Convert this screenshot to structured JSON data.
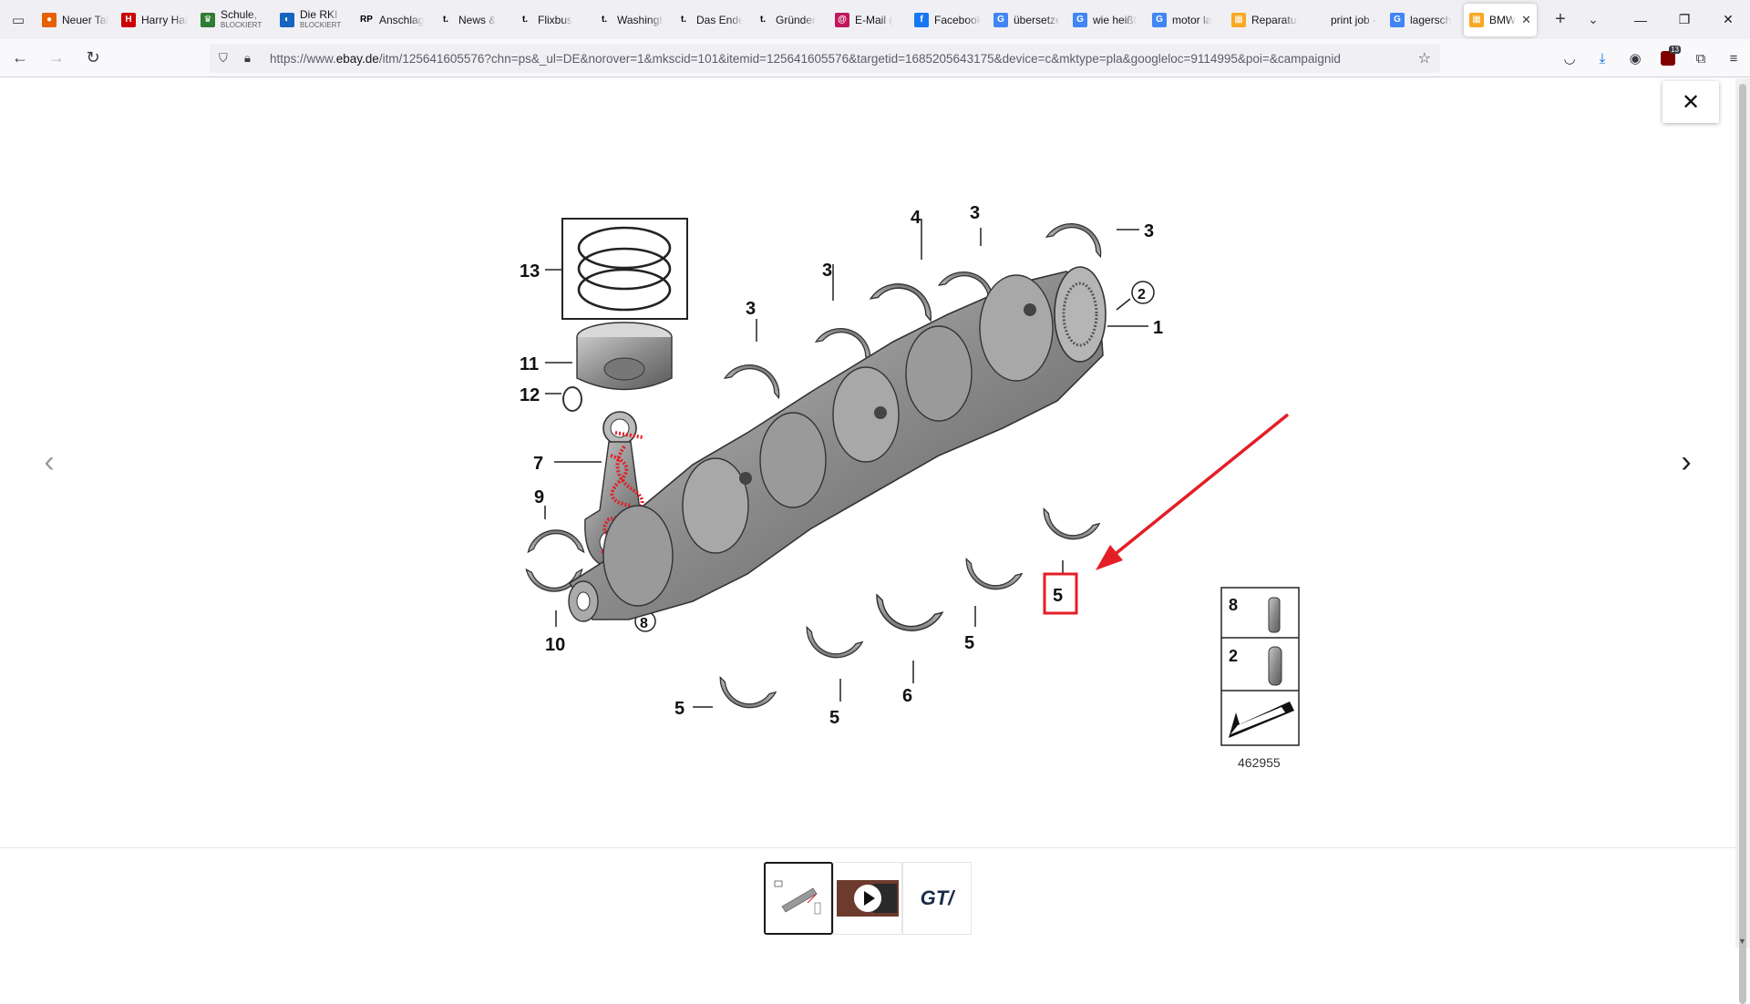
{
  "tabs": [
    {
      "title": "Neuer Tab",
      "fav_color": "#e66000",
      "fav_glyph": "●"
    },
    {
      "title": "Harry Hanks",
      "fav_color": "#cc0000",
      "fav_glyph": "H"
    },
    {
      "title": "Schule,",
      "sub": "BLOCKIERT",
      "fav_color": "#2e7d32",
      "fav_glyph": "♛"
    },
    {
      "title": "Die RKI",
      "sub": "BLOCKIERT",
      "fav_color": "#1565c0",
      "fav_glyph": "◐"
    },
    {
      "title": "Anschlag",
      "fav_color": "#000000",
      "fav_glyph": "RP"
    },
    {
      "title": "News &",
      "fav_color": "#000000",
      "fav_glyph": "t."
    },
    {
      "title": "Flixbus",
      "fav_color": "#000000",
      "fav_glyph": "t."
    },
    {
      "title": "Washington",
      "fav_color": "#000000",
      "fav_glyph": "t."
    },
    {
      "title": "Das Ende",
      "fav_color": "#000000",
      "fav_glyph": "t."
    },
    {
      "title": "Gründer",
      "fav_color": "#000000",
      "fav_glyph": "t."
    },
    {
      "title": "E-Mail (",
      "fav_color": "#c2185b",
      "fav_glyph": "@"
    },
    {
      "title": "Facebook",
      "fav_color": "#1877f2",
      "fav_glyph": "f"
    },
    {
      "title": "übersetzen",
      "fav_color": "#4285f4",
      "fav_glyph": "G"
    },
    {
      "title": "wie heißt",
      "fav_color": "#4285f4",
      "fav_glyph": "G"
    },
    {
      "title": "motor la",
      "fav_color": "#4285f4",
      "fav_glyph": "G"
    },
    {
      "title": "Reparatur",
      "fav_color": "#f9a825",
      "fav_glyph": "▦"
    },
    {
      "title": "print job - P",
      "fav_color": "#f0f0f4",
      "fav_glyph": ""
    },
    {
      "title": "lagersch",
      "fav_color": "#4285f4",
      "fav_glyph": "G"
    },
    {
      "title": "BMW",
      "fav_color": "#f9a825",
      "fav_glyph": "▦",
      "active": true
    }
  ],
  "url": {
    "prefix": "https://www.",
    "domain": "ebay.de",
    "rest": "/itm/125641605576?chn=ps&_ul=DE&norover=1&mkscid=101&itemid=125641605576&targetid=1685205643175&device=c&mktype=pla&googleloc=9114995&poi=&campaignid"
  },
  "extensions_badge": "13",
  "viewer": {
    "close_label": "✕",
    "prev_label": "‹",
    "next_label": "›"
  },
  "diagram": {
    "image_number": "462955",
    "callouts": [
      "13",
      "11",
      "12",
      "7",
      "9",
      "10",
      "8",
      "3",
      "4",
      "3",
      "3",
      "3",
      "2",
      "1",
      "5",
      "5",
      "5",
      "6",
      "5",
      "5"
    ],
    "legend": [
      "8",
      "2"
    ]
  },
  "thumbnails": [
    {
      "label": "diagram"
    },
    {
      "label": "video"
    },
    {
      "label": "GT/"
    }
  ],
  "colors": {
    "annotation_red": "#e41e26",
    "part_gray": "#8e8e8e"
  }
}
